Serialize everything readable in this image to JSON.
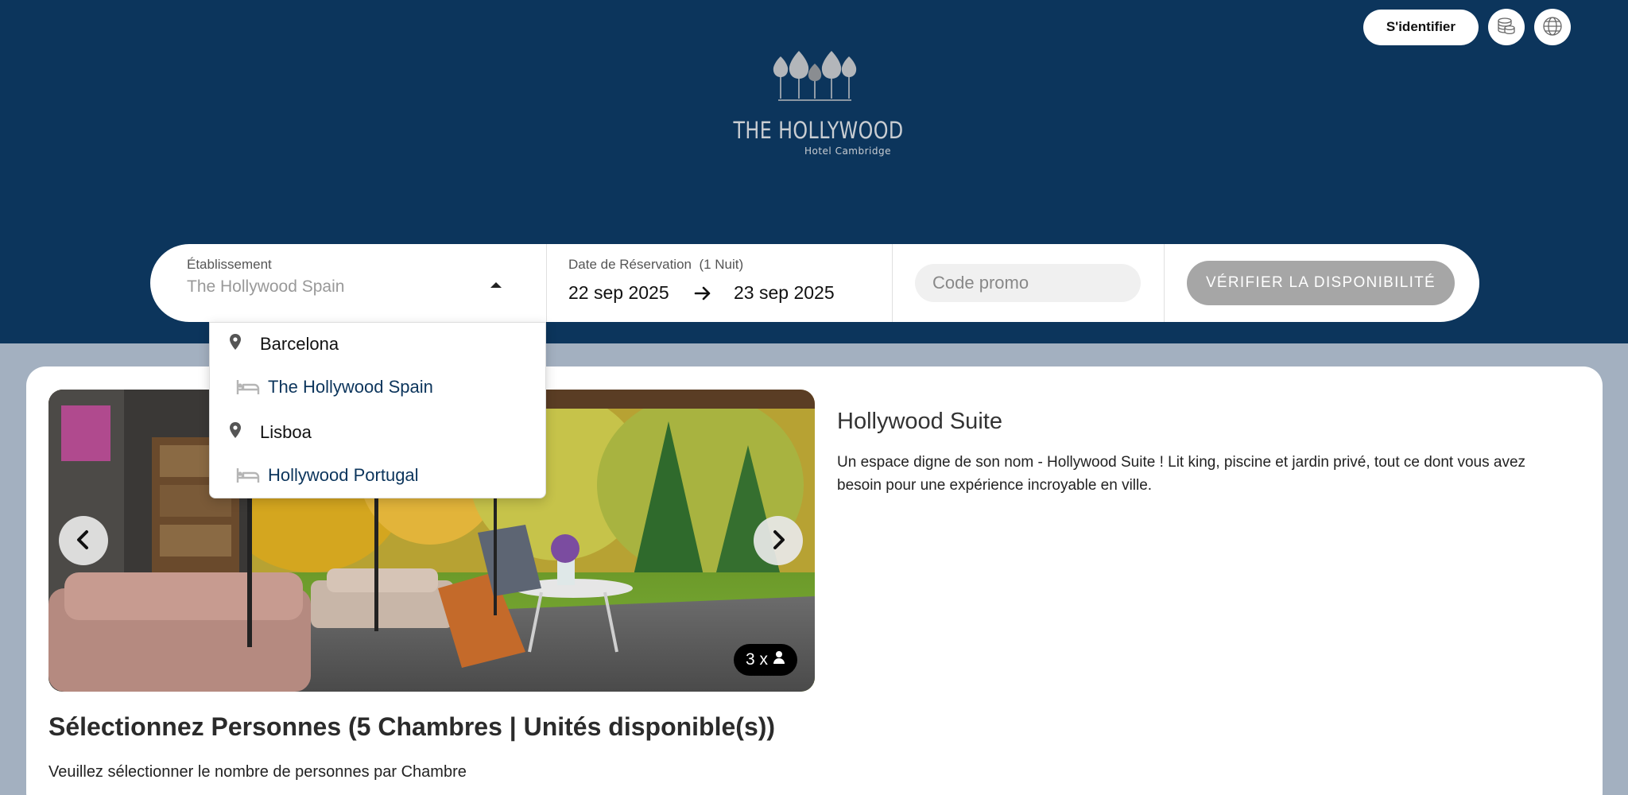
{
  "header": {
    "signin_label": "S'identifier",
    "currency_icon": "coins-icon",
    "language_icon": "globe-icon",
    "logo_name": "THE HOLLYWOOD",
    "logo_subtitle": "Hotel Cambridge",
    "background_color": "#0c355c"
  },
  "search": {
    "establishment_label": "Établissement",
    "establishment_value": "The Hollywood Spain",
    "dates_label": "Date de Réservation",
    "nights_label": "(1 Nuit)",
    "date_from": "22 sep 2025",
    "date_to": "23 sep 2025",
    "promo_placeholder": "Code promo",
    "check_button": "VÉRIFIER LA DISPONIBILITÉ"
  },
  "dropdown": {
    "items": [
      {
        "type": "city",
        "icon": "map-pin-icon",
        "label": "Barcelona"
      },
      {
        "type": "hotel",
        "icon": "bed-icon",
        "label": "The Hollywood Spain"
      },
      {
        "type": "city",
        "icon": "map-pin-icon",
        "label": "Lisboa"
      },
      {
        "type": "hotel",
        "icon": "bed-icon",
        "label": "Hollywood Portugal"
      }
    ]
  },
  "room": {
    "title": "Hollywood Suite",
    "description": "Un espace digne de son nom - Hollywood Suite ! Lit king, piscine et jardin privé, tout ce dont vous avez besoin pour une expérience incroyable en ville.",
    "guests_badge": "3 x",
    "select_title": "Sélectionnez Personnes (5 Chambres | Unités disponible(s))",
    "select_subtitle": "Veuillez sélectionner le nombre de personnes par Chambre"
  }
}
